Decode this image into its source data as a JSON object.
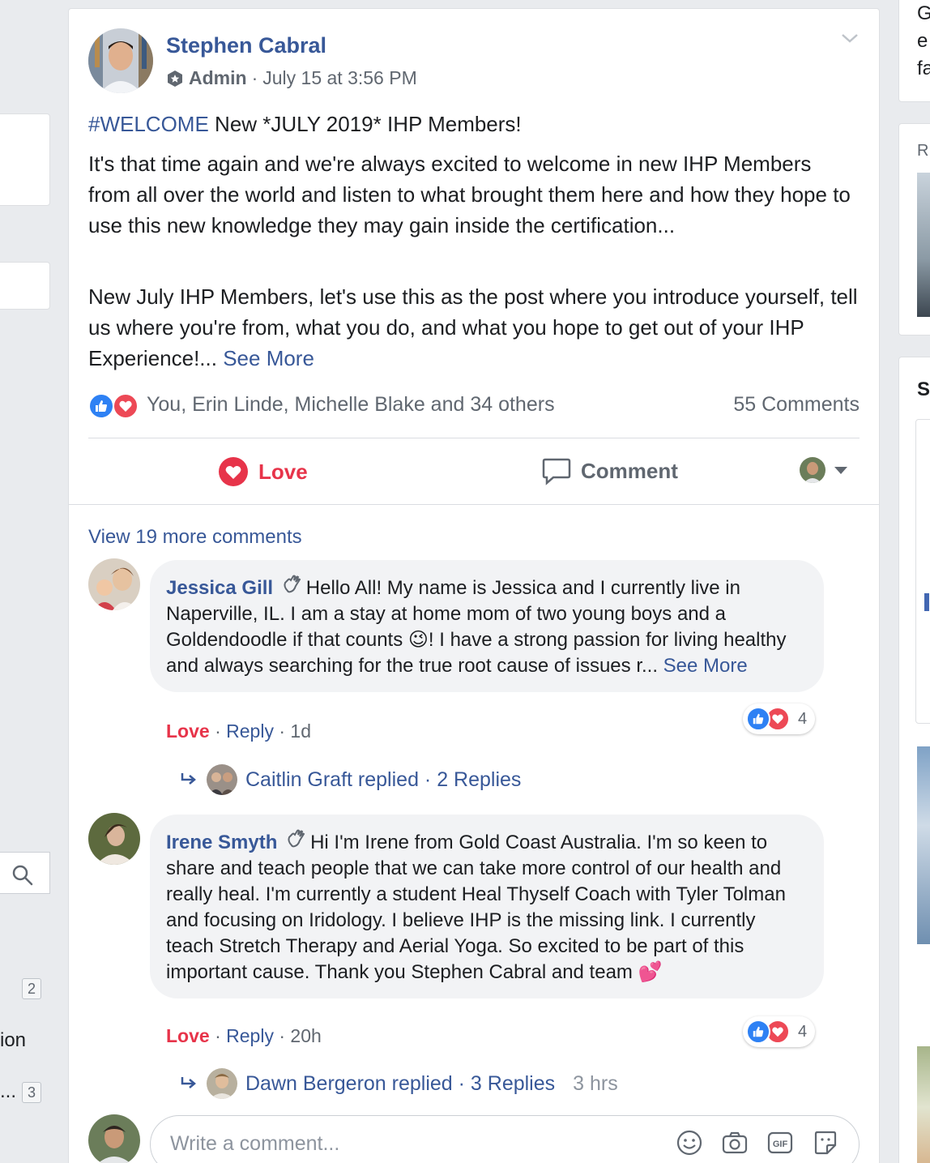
{
  "post": {
    "author": "Stephen Cabral",
    "role": "Admin",
    "timestamp": "July 15 at 3:56 PM",
    "hashtag": "#WELCOME",
    "headline": " New *JULY 2019* IHP Members!",
    "para1": "It's that time again and we're always excited to welcome in new IHP Members from all over the world and listen to what brought them here and how they hope to use this new knowledge they may gain inside the certification...",
    "para2": "New July IHP Members, let's use this as the post where you introduce yourself, tell us where you're from, what you do, and what you hope to get out of your IHP Experience!... ",
    "see_more": "See More",
    "reaction_names": "You, Erin Linde, Michelle Blake and 34 others",
    "comment_count": "55 Comments"
  },
  "actions": {
    "love": "Love",
    "comment": "Comment"
  },
  "comments_section": {
    "view_more": "View 19 more comments",
    "write_placeholder": "Write a comment..."
  },
  "comments": [
    {
      "name": "Jessica Gill",
      "text": "Hello All! My name is Jessica and I currently live in Naperville, IL. I am a stay at home mom of two young boys and a Goldendoodle if that counts ",
      "emoji": "😉",
      "text2": "! I have a strong passion for living healthy and always searching for the true root cause of issues r... ",
      "see_more": "See More",
      "love": "Love",
      "reply": "Reply",
      "age": "1d",
      "reaction_count": "4",
      "reply_summary": "Caitlin Graft replied · 2 Replies"
    },
    {
      "name": "Irene Smyth",
      "text": "Hi I'm Irene from Gold Coast Australia. I'm so keen to share and teach people that we can take more control of our health and really heal. I'm currently a student Heal Thyself Coach with Tyler Tolman and focusing on Iridology. I believe IHP is the missing link. I currently teach Stretch Therapy and Aerial Yoga. So excited to be part of this important cause. Thank you Stephen Cabral and team ",
      "emoji": "💕",
      "love": "Love",
      "reply": "Reply",
      "age": "20h",
      "reaction_count": "4",
      "reply_summary": "Dawn Bergeron replied · 3 Replies",
      "reply_time": "3 hrs"
    }
  ],
  "left_sidebar": {
    "badge1": "2",
    "text1": "ion",
    "text2": "...",
    "badge2": "3"
  },
  "right_sidebar": {
    "l1": "G",
    "l2": "e",
    "l3": "fa",
    "l4": "R",
    "l5": "S"
  },
  "colors": {
    "link": "#385898",
    "love": "#e7344a",
    "like": "#2e81f4",
    "muted": "#606770"
  }
}
